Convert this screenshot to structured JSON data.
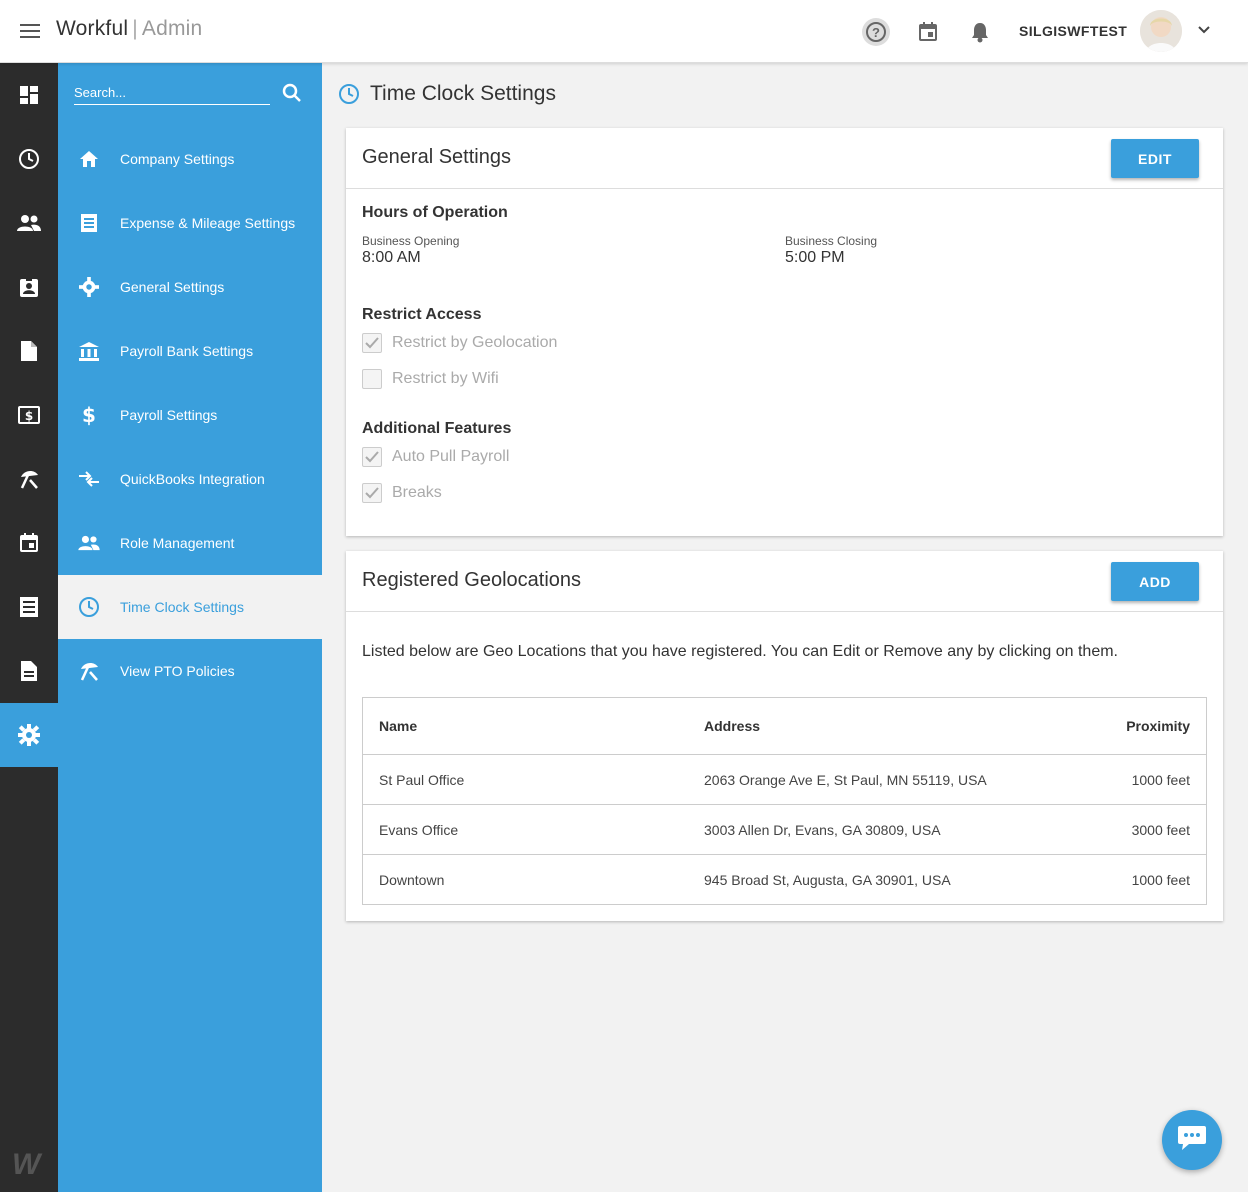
{
  "header": {
    "brand": "Workful",
    "separator": "|",
    "brand_sub": "Admin",
    "help_glyph": "?",
    "username": "SILGISWFTEST"
  },
  "rail": {
    "icons": [
      "dashboard-icon",
      "clock-icon",
      "people-icon",
      "badge-icon",
      "file-icon",
      "money-icon",
      "beach-icon",
      "calendar-icon",
      "receipt-icon",
      "document-icon",
      "gear-icon"
    ],
    "active": "gear-icon",
    "logo": "W"
  },
  "settings_nav": {
    "search_placeholder": "Search...",
    "items": [
      {
        "label": "Company Settings",
        "icon": "home-icon"
      },
      {
        "label": "Expense & Mileage Settings",
        "icon": "receipt-icon"
      },
      {
        "label": "General Settings",
        "icon": "gear-icon"
      },
      {
        "label": "Payroll Bank Settings",
        "icon": "bank-icon"
      },
      {
        "label": "Payroll Settings",
        "icon": "dollar-icon"
      },
      {
        "label": "QuickBooks Integration",
        "icon": "sync-arrows-icon"
      },
      {
        "label": "Role Management",
        "icon": "people-icon"
      },
      {
        "label": "Time Clock Settings",
        "icon": "clock-icon",
        "active": true
      },
      {
        "label": "View PTO Policies",
        "icon": "beach-icon"
      }
    ]
  },
  "page": {
    "title": "Time Clock Settings"
  },
  "general": {
    "title": "General Settings",
    "edit_label": "EDIT",
    "hours_heading": "Hours of Operation",
    "opening_label": "Business Opening",
    "opening_value": "8:00 AM",
    "closing_label": "Business Closing",
    "closing_value": "5:00 PM",
    "restrict_heading": "Restrict Access",
    "restrict_geo": "Restrict by Geolocation",
    "restrict_geo_checked": true,
    "restrict_wifi": "Restrict by Wifi",
    "restrict_wifi_checked": false,
    "features_heading": "Additional Features",
    "auto_pull": "Auto Pull Payroll",
    "auto_pull_checked": true,
    "breaks": "Breaks",
    "breaks_checked": true
  },
  "geo": {
    "title": "Registered Geolocations",
    "add_label": "ADD",
    "description": "Listed below are Geo Locations that you have registered. You can Edit or Remove any by clicking on them.",
    "columns": {
      "name": "Name",
      "address": "Address",
      "proximity": "Proximity"
    },
    "rows": [
      {
        "name": "St Paul Office",
        "address": "2063 Orange Ave E, St Paul, MN 55119, USA",
        "proximity": "1000 feet"
      },
      {
        "name": "Evans Office",
        "address": "3003 Allen Dr, Evans, GA 30809, USA",
        "proximity": "3000 feet"
      },
      {
        "name": "Downtown",
        "address": "945 Broad St, Augusta, GA 30901, USA",
        "proximity": "1000 feet"
      }
    ]
  },
  "colors": {
    "accent": "#3a9fdc",
    "rail": "#2c2c2c",
    "background": "#f2f2f2"
  }
}
